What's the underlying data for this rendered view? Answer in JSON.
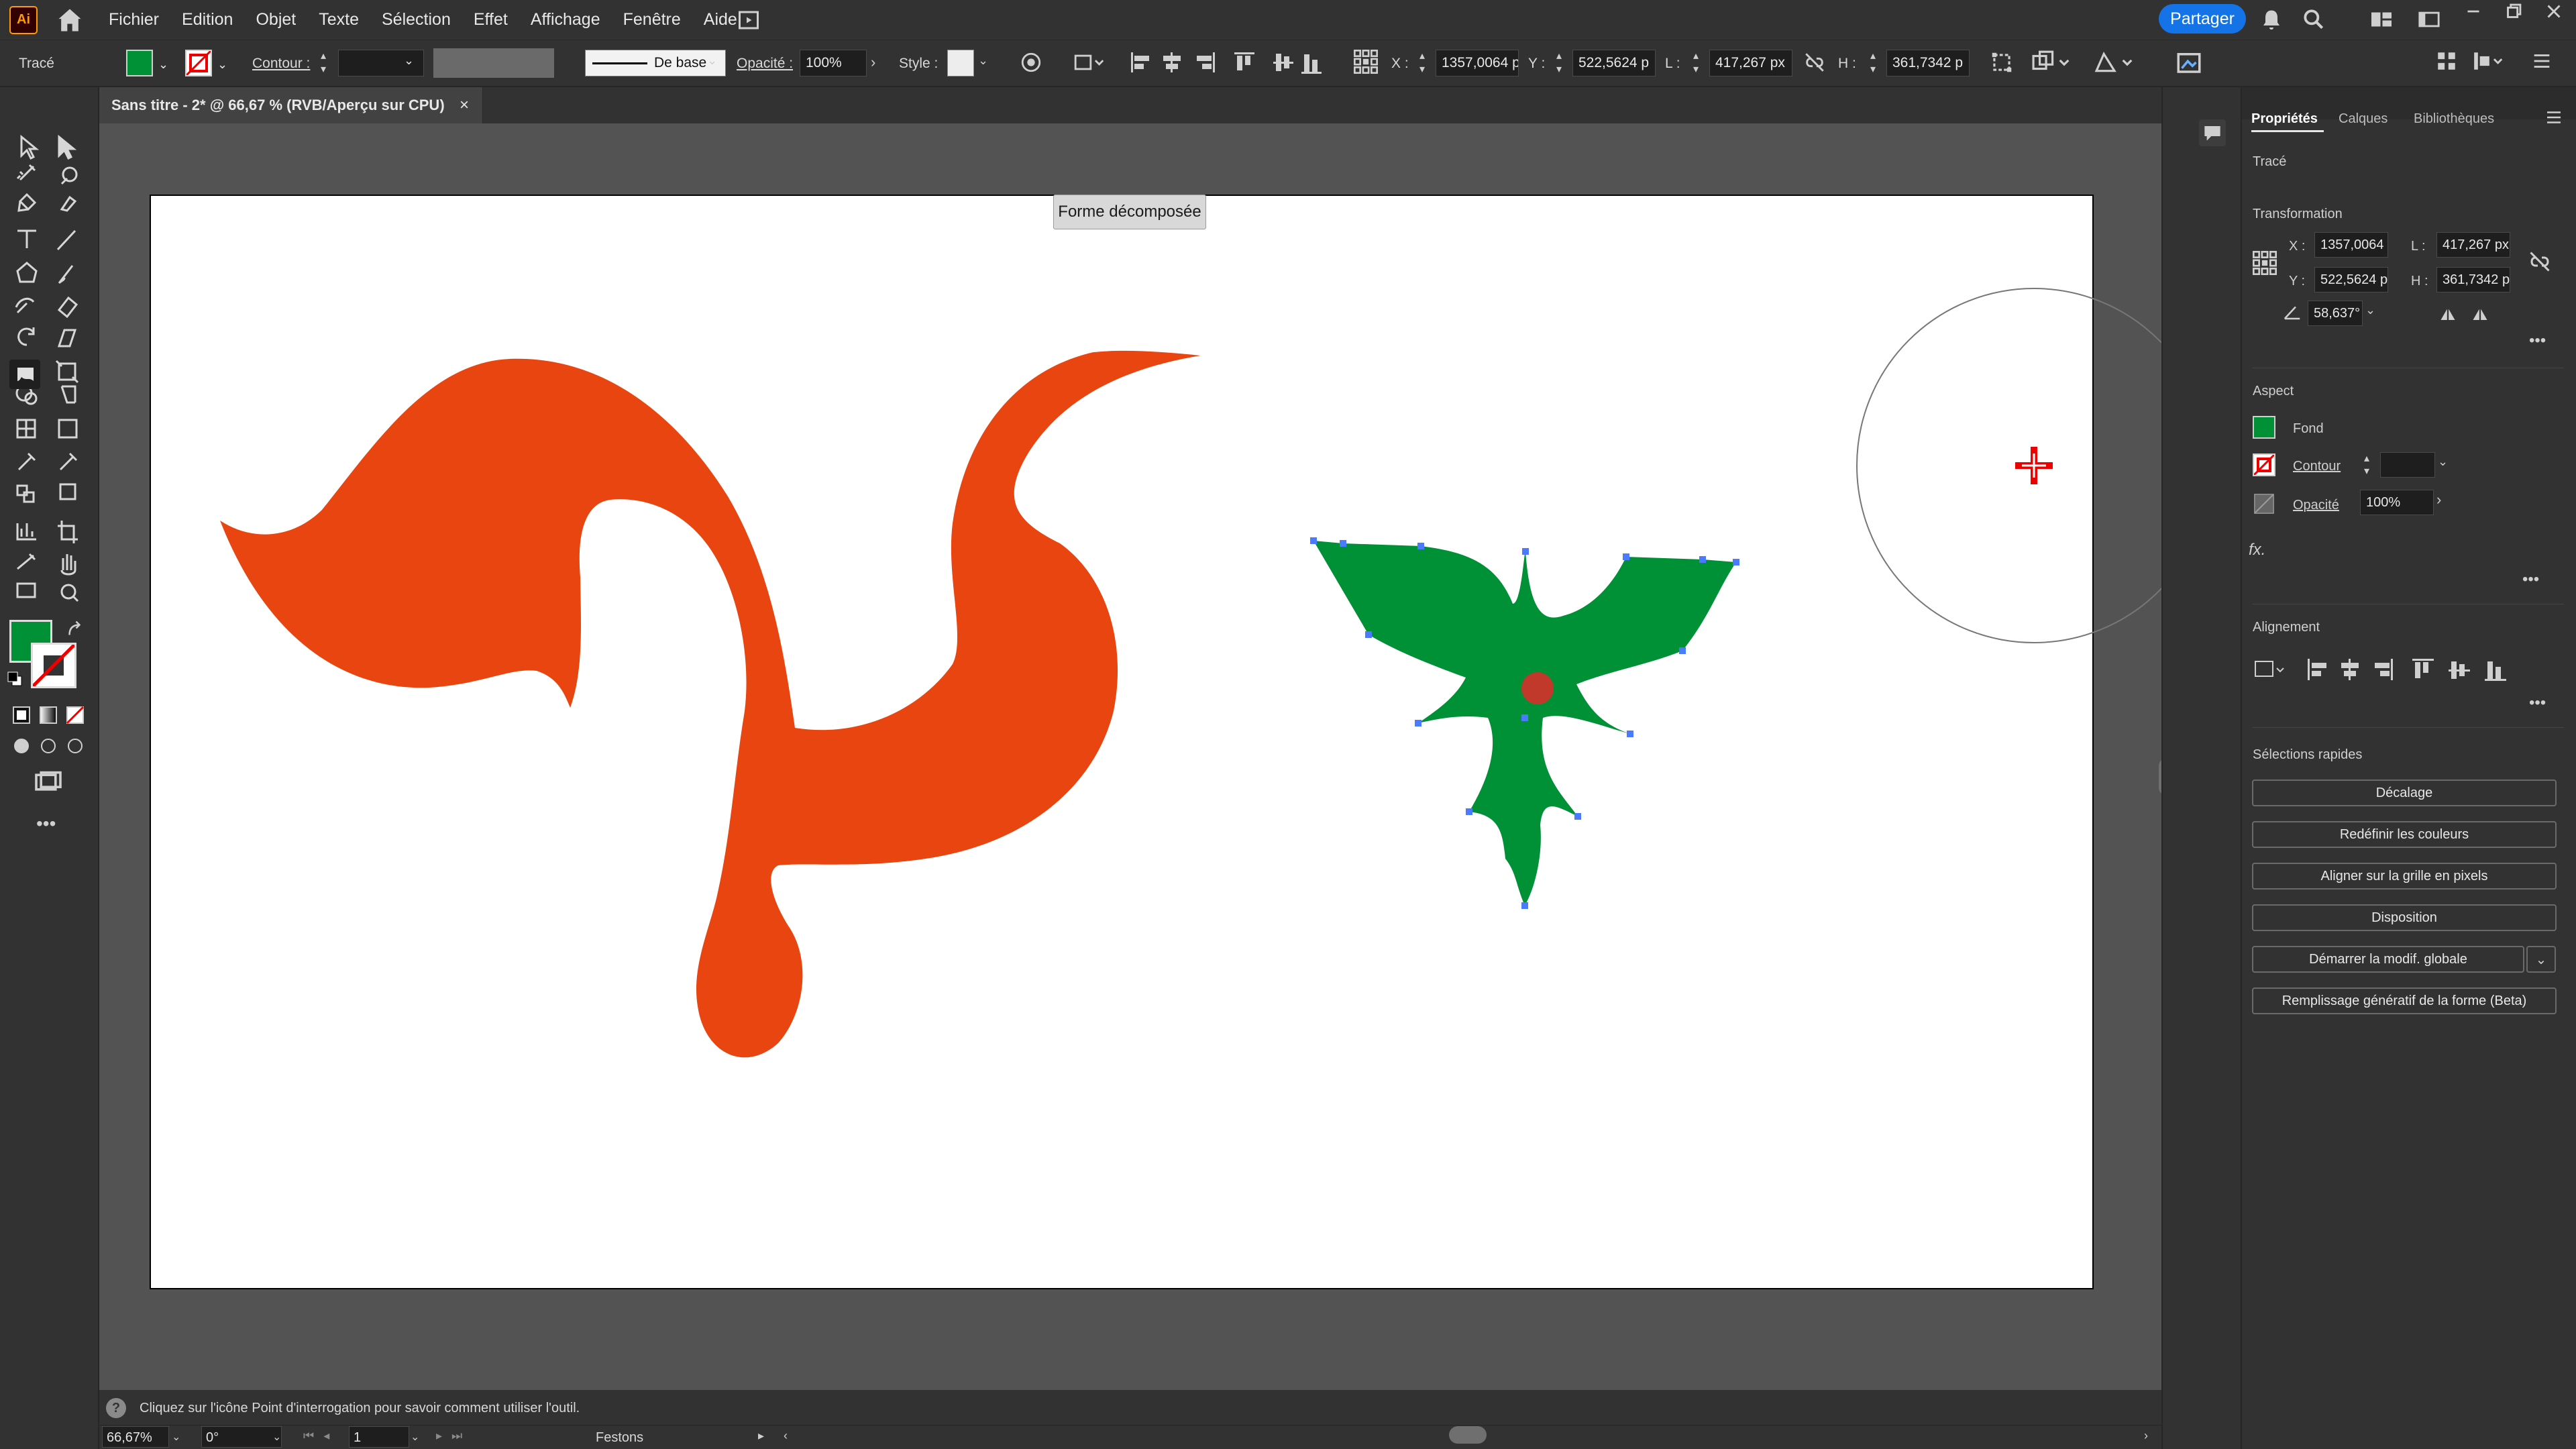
{
  "menubar": {
    "app_logo": "Ai",
    "items": [
      "Fichier",
      "Edition",
      "Objet",
      "Texte",
      "Sélection",
      "Effet",
      "Affichage",
      "Fenêtre",
      "Aide"
    ],
    "share_label": "Partager"
  },
  "control_bar": {
    "object_type": "Tracé",
    "stroke_label": "Contour :",
    "stroke_style": "De base",
    "opacity_label": "Opacité :",
    "opacity_value": "100%",
    "style_label": "Style :",
    "x_label": "X :",
    "x_value": "1357,0064 p",
    "y_label": "Y :",
    "y_value": "522,5624 p",
    "w_label": "L :",
    "w_value": "417,267 px",
    "h_label": "H :",
    "h_value": "361,7342 p",
    "fill_color": "#009036"
  },
  "document_tab": {
    "title": "Sans titre - 2* @ 66,67 % (RVB/Aperçu sur CPU)",
    "close_glyph": "×"
  },
  "canvas": {
    "tooltip": "Forme décomposée",
    "shape_colors": {
      "orange": "#e84511",
      "green": "#009036",
      "center_dot": "#c0392b"
    }
  },
  "properties_panel": {
    "tabs": [
      "Propriétés",
      "Calques",
      "Bibliothèques"
    ],
    "object_type": "Tracé",
    "transformation_title": "Transformation",
    "x_label": "X :",
    "x_value": "1357,0064",
    "y_label": "Y :",
    "y_value": "522,5624 p",
    "w_label": "L :",
    "w_value": "417,267 px",
    "h_label": "H :",
    "h_value": "361,7342 p",
    "angle_value": "58,637°",
    "aspect_title": "Aspect",
    "fill_label": "Fond",
    "stroke_label": "Contour",
    "opacity_label": "Opacité",
    "opacity_value": "100%",
    "fx_label": "fx.",
    "alignment_title": "Alignement",
    "quick_actions_title": "Sélections rapides",
    "quick_actions": [
      "Décalage",
      "Redéfinir les couleurs",
      "Aligner sur la grille en pixels",
      "Disposition",
      "Démarrer la modif. globale",
      "Remplissage génératif de la forme (Beta)"
    ]
  },
  "help_bar": {
    "text": "Cliquez sur l'icône Point d'interrogation pour savoir comment utiliser l'outil."
  },
  "status_bar": {
    "zoom": "66,67%",
    "rotation": "0°",
    "artboard_number": "1",
    "tool_name": "Festons"
  },
  "tools": {
    "fill_color": "#009036",
    "stroke_color": "none"
  }
}
